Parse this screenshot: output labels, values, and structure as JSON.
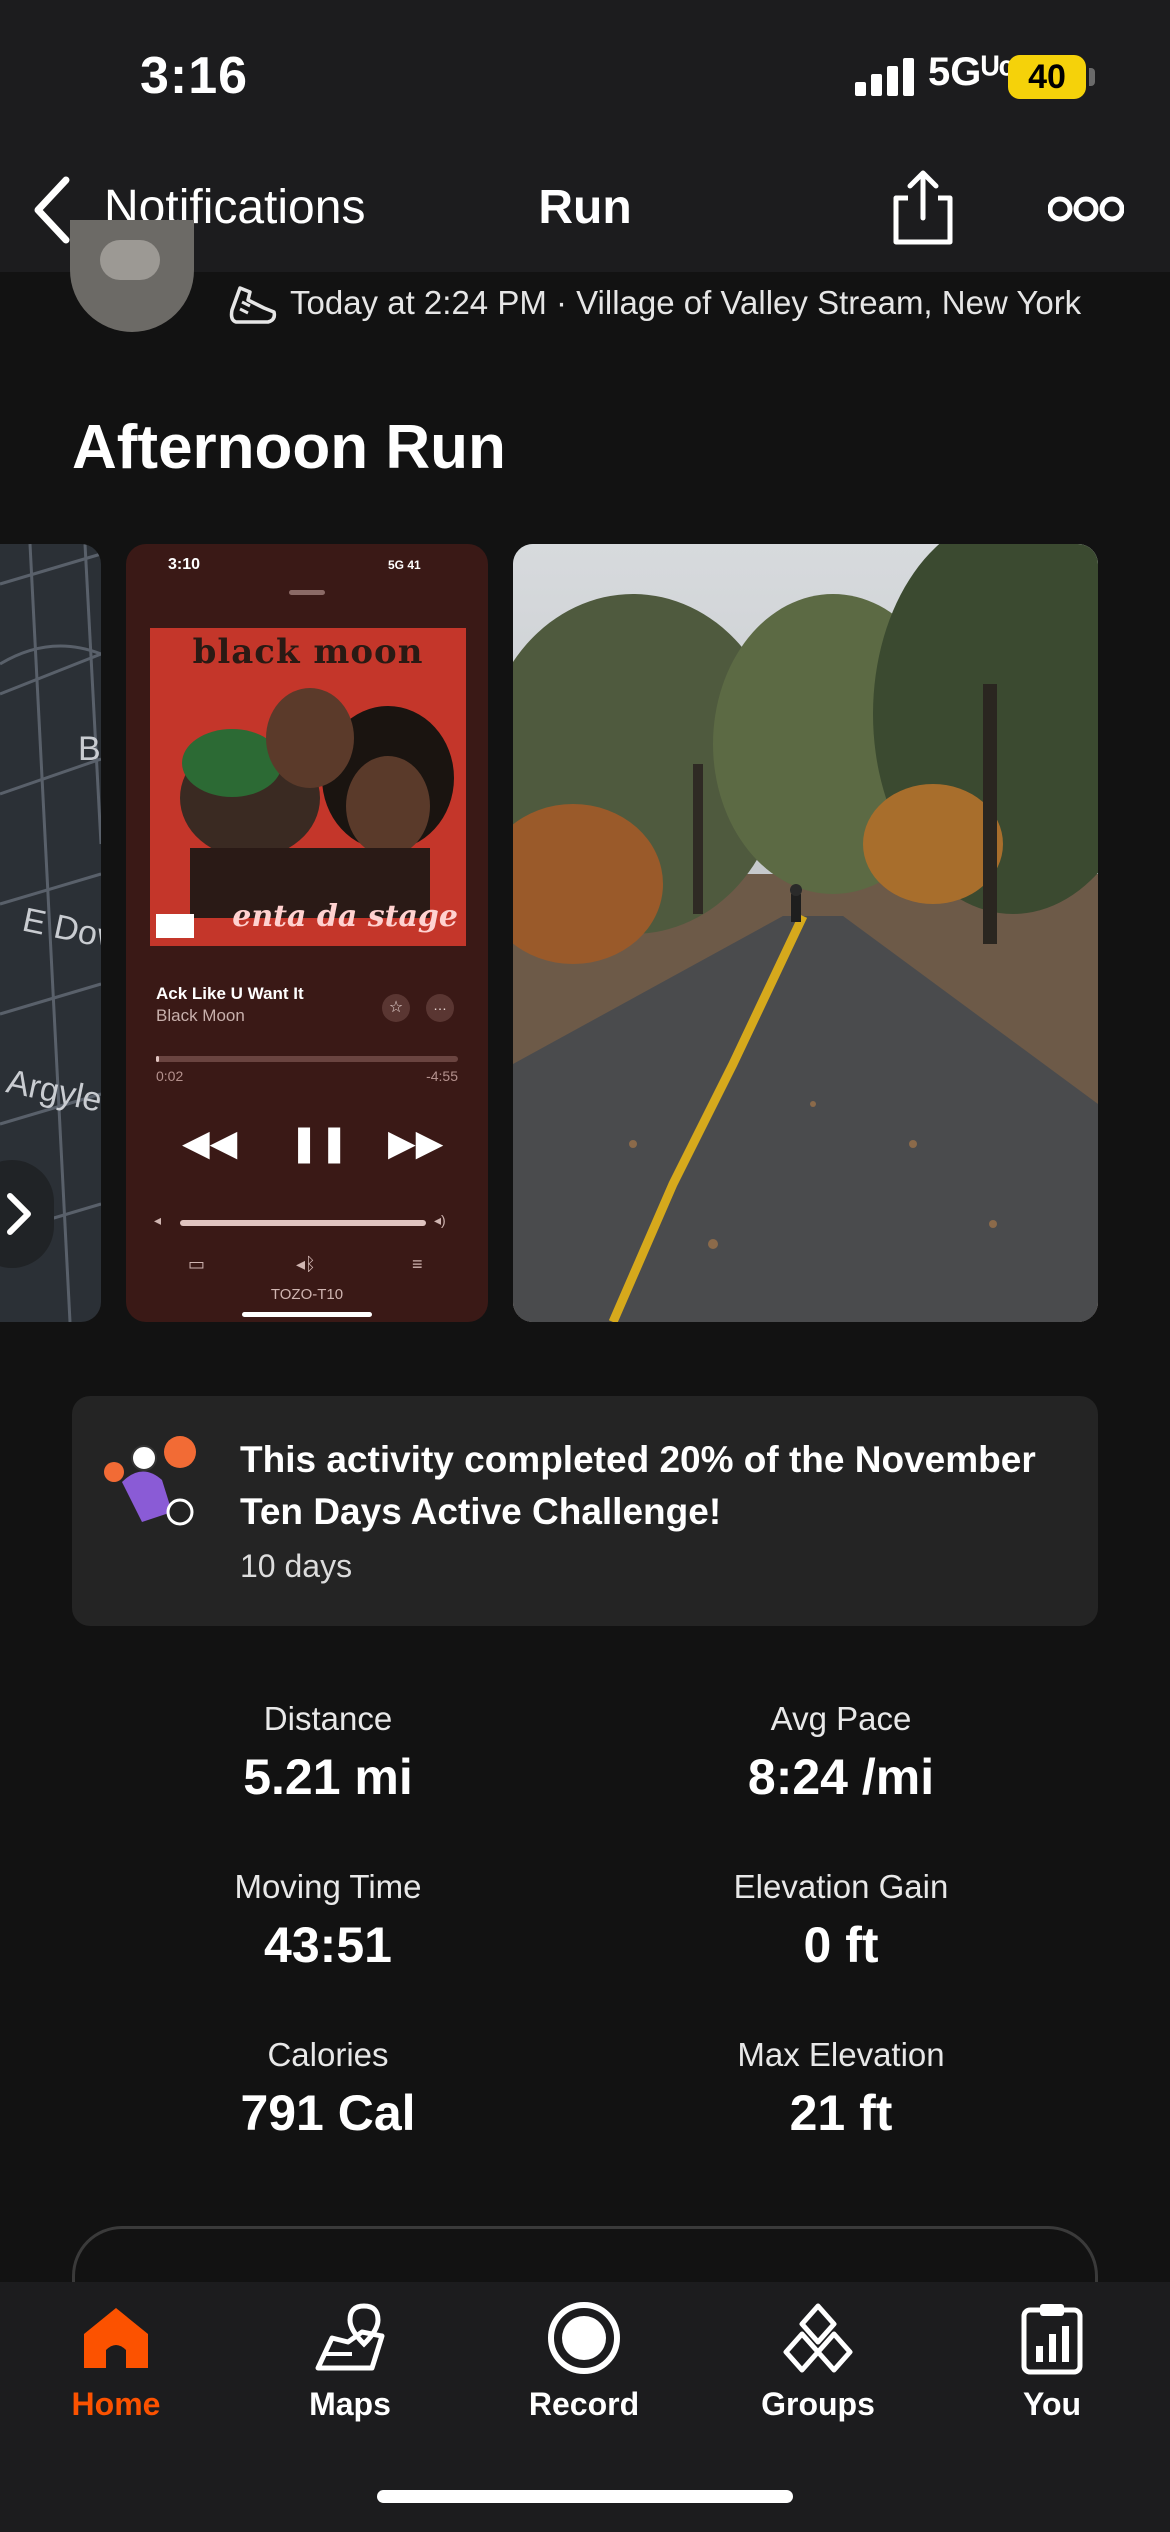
{
  "status_bar": {
    "time": "3:16",
    "network": "5Gᵁᶜ",
    "battery": "40"
  },
  "nav": {
    "back_label": "Notifications",
    "title": "Run"
  },
  "activity": {
    "meta": "Today at 2:24 PM · Village of Valley Stream, New York",
    "title": "Afternoon Run"
  },
  "media": {
    "map_labels": [
      "B",
      "E Dov",
      "Argyle"
    ],
    "music": {
      "time": "3:10",
      "status": "5G 41",
      "album_title": "black moon",
      "album_subtitle": "enta da stage",
      "advisory": "PARENTAL ADVISORY",
      "track": "Ack Like U Want It",
      "artist": "Black Moon",
      "elapsed": "0:02",
      "remaining": "-4:55",
      "progress": 0.01,
      "device": "TOZO-T10"
    }
  },
  "challenge": {
    "text": "This activity completed 20% of the November Ten Days Active Challenge!",
    "sub": "10 days"
  },
  "stats": [
    {
      "label": "Distance",
      "value": "5.21 mi"
    },
    {
      "label": "Avg Pace",
      "value": "8:24 /mi"
    },
    {
      "label": "Moving Time",
      "value": "43:51"
    },
    {
      "label": "Elevation Gain",
      "value": "0 ft"
    },
    {
      "label": "Calories",
      "value": "791 Cal"
    },
    {
      "label": "Max Elevation",
      "value": "21 ft"
    }
  ],
  "tabs": [
    {
      "label": "Home",
      "icon": "home-icon",
      "active": true
    },
    {
      "label": "Maps",
      "icon": "map-icon",
      "active": false
    },
    {
      "label": "Record",
      "icon": "record-icon",
      "active": false
    },
    {
      "label": "Groups",
      "icon": "groups-icon",
      "active": false
    },
    {
      "label": "You",
      "icon": "clipboard-icon",
      "active": false
    }
  ],
  "colors": {
    "accent": "#fc5200",
    "background": "#121212",
    "card": "#242424",
    "bar": "#1c1c1e"
  }
}
